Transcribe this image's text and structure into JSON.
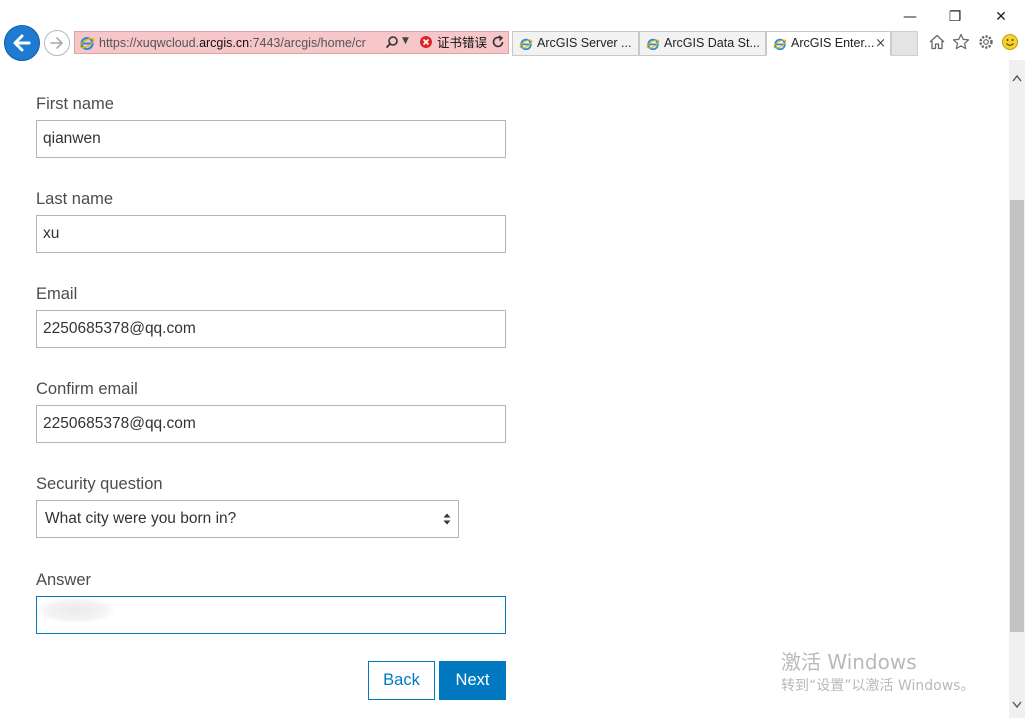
{
  "browser": {
    "address_url_prefix": "https://xuqwcloud.",
    "address_url_domain": "arcgis.cn",
    "address_url_suffix": ":7443/arcgis/home/cr",
    "cert_error": "证书错误",
    "tabs": [
      {
        "label": "ArcGIS Server ...",
        "active": false
      },
      {
        "label": "ArcGIS Data St...",
        "active": false
      },
      {
        "label": "ArcGIS Enter...",
        "active": true
      }
    ],
    "close_tab_glyph": "×",
    "window_controls": {
      "minimize": "—",
      "restore": "❐",
      "close": "✕"
    },
    "icons": [
      "back-arrow-icon",
      "forward-arrow-icon",
      "ie-icon",
      "search-icon",
      "cert-error-icon",
      "refresh-icon",
      "home-icon",
      "favorites-star-icon",
      "settings-gear-icon",
      "smiley-feedback-icon"
    ]
  },
  "form": {
    "first_name": {
      "label": "First name",
      "value": "qianwen"
    },
    "last_name": {
      "label": "Last name",
      "value": "xu"
    },
    "email": {
      "label": "Email",
      "value": "2250685378@qq.com"
    },
    "confirm_email": {
      "label": "Confirm email",
      "value": "2250685378@qq.com"
    },
    "security_question": {
      "label": "Security question",
      "value": "What city were you born in?"
    },
    "answer": {
      "label": "Answer",
      "value": ""
    },
    "back_label": "Back",
    "next_label": "Next"
  },
  "watermark": {
    "title": "激活 Windows",
    "subtitle": "转到“设置”以激活 Windows。"
  },
  "colors": {
    "accent": "#0079c1",
    "address_error_bg": "#f6c6c9",
    "label_text": "#4c4c4c"
  }
}
